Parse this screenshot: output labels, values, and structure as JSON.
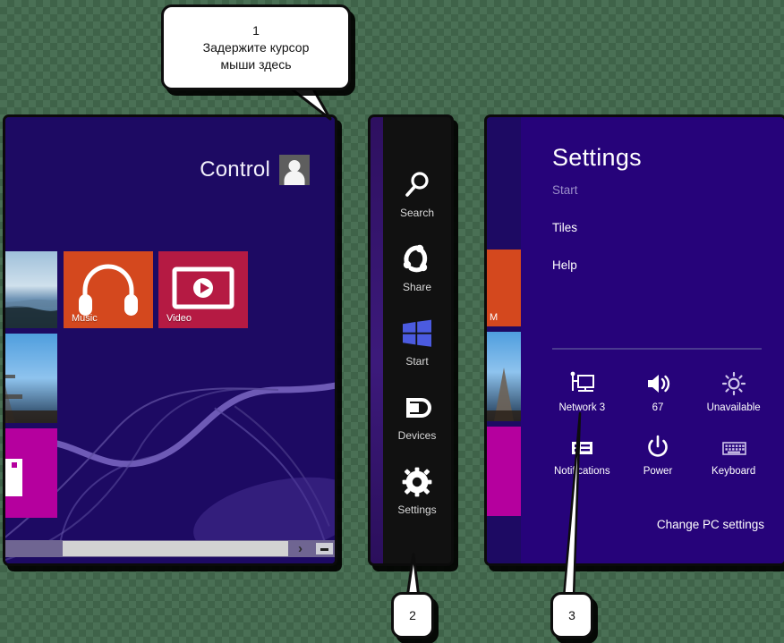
{
  "callouts": [
    {
      "id": "1",
      "number": "1",
      "text": "Задержите курсор\nмыши здесь"
    },
    {
      "id": "2",
      "number": "2",
      "text": ""
    },
    {
      "id": "3",
      "number": "3",
      "text": ""
    }
  ],
  "start_screen": {
    "user_name": "Control",
    "avatar_icon": "user-avatar-icon",
    "tiles": [
      {
        "name": "photo-tile-1",
        "label": "",
        "color": "#2c5a86",
        "icon": "photo-icon"
      },
      {
        "name": "music-tile",
        "label": "Music",
        "color": "#d4481e",
        "icon": "headphones-icon"
      },
      {
        "name": "video-tile",
        "label": "Video",
        "color": "#b51a43",
        "icon": "video-play-icon"
      },
      {
        "name": "photo-tile-2",
        "label": "",
        "color": "#4a8fc7",
        "icon": "photo-icon"
      },
      {
        "name": "camera-tile",
        "label": "",
        "color": "#b5009e",
        "icon": "camera-icon"
      }
    ],
    "scrollbar": {
      "arrow_glyph": "›",
      "minimize_icon": "minimize-icon"
    }
  },
  "charms_bar": {
    "items": [
      {
        "label": "Search",
        "icon": "search-icon"
      },
      {
        "label": "Share",
        "icon": "share-icon"
      },
      {
        "label": "Start",
        "icon": "windows-logo-icon"
      },
      {
        "label": "Devices",
        "icon": "devices-icon"
      },
      {
        "label": "Settings",
        "icon": "gear-icon"
      }
    ]
  },
  "settings_flyout": {
    "title": "Settings",
    "links": [
      {
        "label": "Start",
        "dimmed": true
      },
      {
        "label": "Tiles",
        "dimmed": false
      },
      {
        "label": "Help",
        "dimmed": false
      }
    ],
    "quick_actions": [
      {
        "label": "Network  3",
        "icon": "network-icon"
      },
      {
        "label": "67",
        "icon": "volume-icon"
      },
      {
        "label": "Unavailable",
        "icon": "brightness-icon"
      },
      {
        "label": "Notifications",
        "icon": "notifications-icon"
      },
      {
        "label": "Power",
        "icon": "power-icon"
      },
      {
        "label": "Keyboard",
        "icon": "keyboard-icon"
      }
    ],
    "change_pc_settings": "Change PC settings",
    "peek_tile_label": "M"
  },
  "colors": {
    "start_background": "#1d0a63",
    "flyout_background": "#26037a",
    "charms_background": "#111111",
    "music_tile": "#d4481e",
    "video_tile": "#b51a43",
    "camera_tile": "#b5009e",
    "windows_logo": "#4b5be0",
    "canvas": "#4a7055"
  }
}
